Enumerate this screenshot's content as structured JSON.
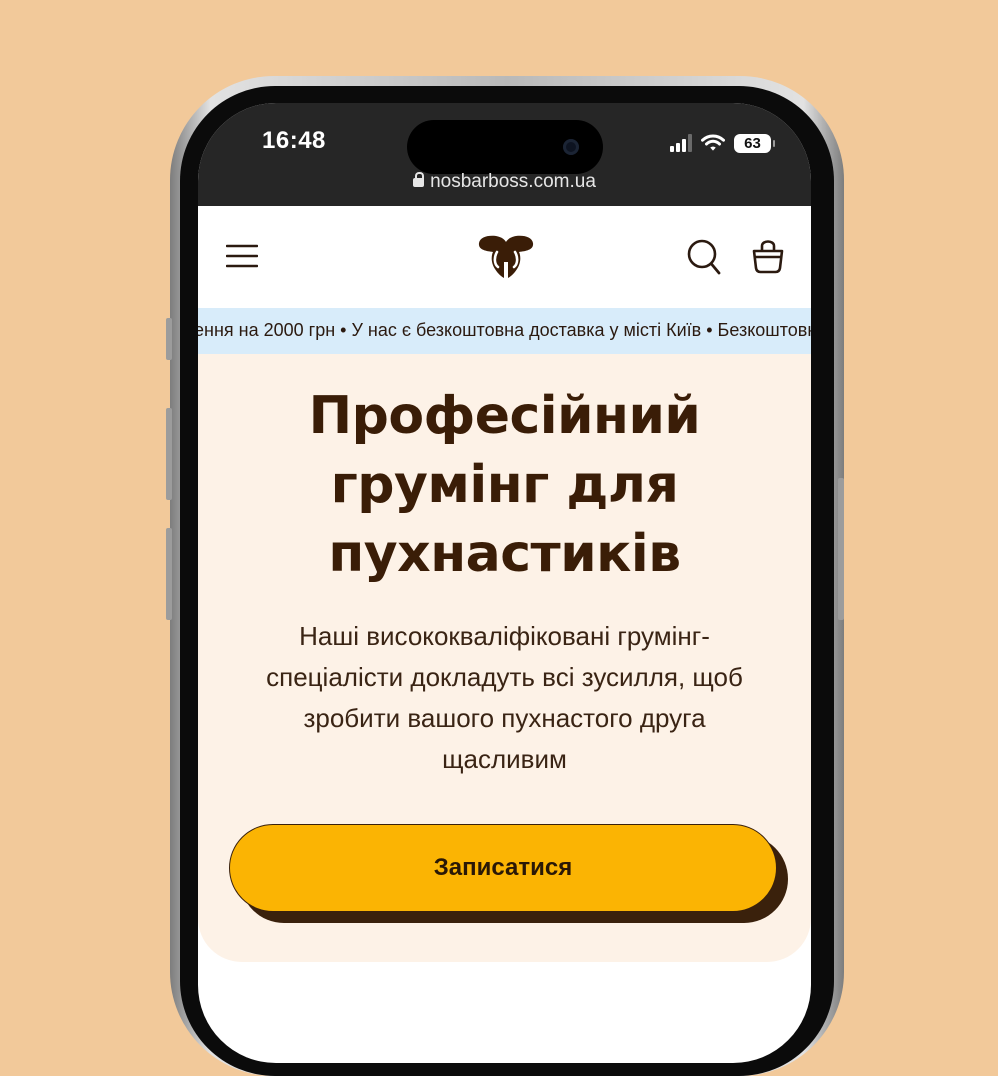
{
  "status_bar": {
    "time": "16:48",
    "battery_level": "63"
  },
  "browser": {
    "url": "nosbarboss.com.ua"
  },
  "header": {
    "menu_icon": "hamburger-menu-icon",
    "logo_icon": "dog-nose-logo-icon",
    "search_icon": "search-icon",
    "cart_icon": "shopping-bag-icon"
  },
  "ticker": {
    "text": "ення на 2000 грн • У нас є безкоштовна доставка у місті Київ • Безкоштовна"
  },
  "hero": {
    "title_lines": [
      "Професійний",
      "грумінг для",
      "пухнастиків"
    ],
    "subtitle_lines": [
      "Наші висококваліфіковані грумінг-",
      "спеціалісти докладуть всі зусилля, щоб",
      "зробити вашого пухнастого друга",
      "щасливим"
    ],
    "cta_label": "Записатися"
  },
  "colors": {
    "page_background": "#f2c99a",
    "hero_background": "#fdf2e7",
    "ticker_background": "#d8ecfa",
    "brand_brown": "#3a1d07",
    "cta_yellow": "#fbb403"
  }
}
